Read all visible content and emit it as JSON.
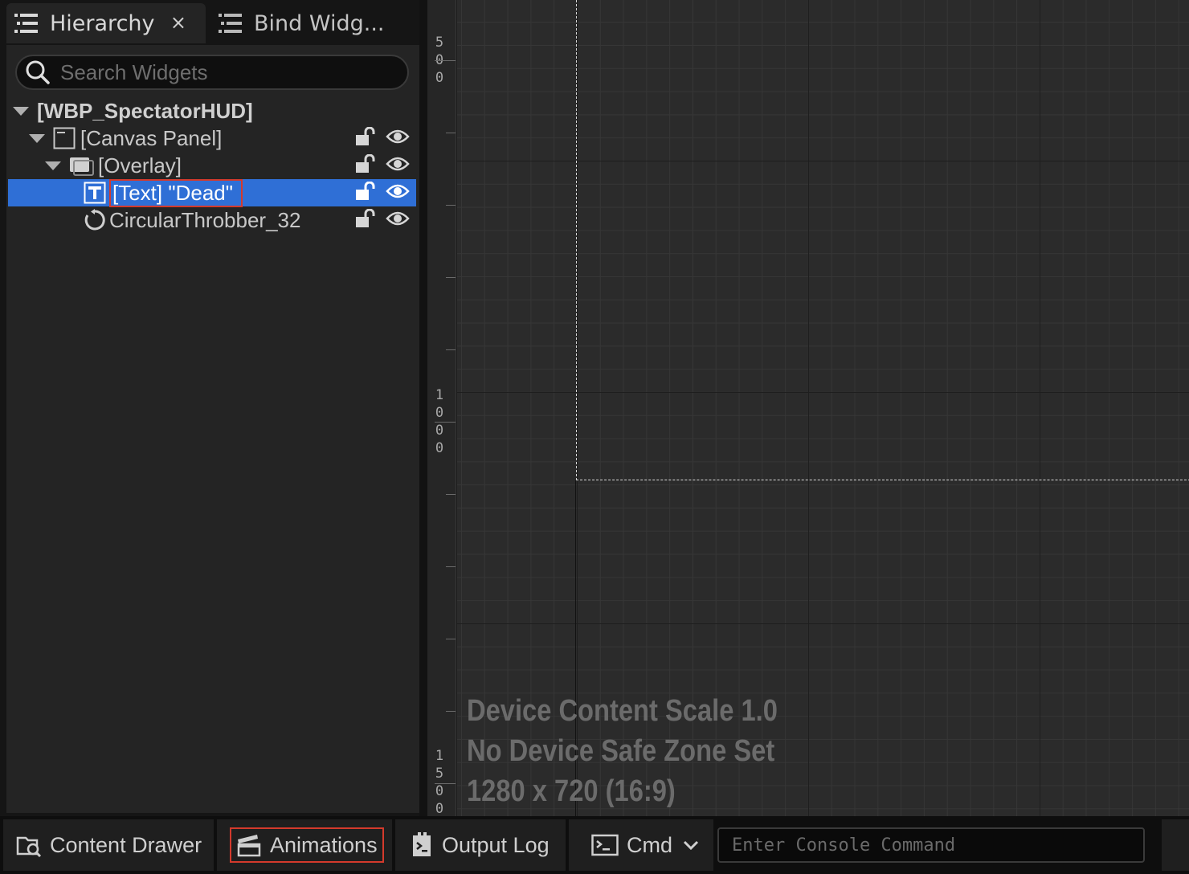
{
  "tabs": [
    {
      "label": "Hierarchy",
      "icon": "hierarchy-list-icon",
      "active": true,
      "close": "×"
    },
    {
      "label": "Bind Widg...",
      "icon": "hierarchy-list-icon",
      "active": false
    }
  ],
  "search": {
    "placeholder": "Search Widgets",
    "value": ""
  },
  "tree": {
    "root": "[WBP_SpectatorHUD]",
    "canvas_panel": "[Canvas Panel]",
    "overlay": "[Overlay]",
    "text_dead": "[Text] \"Dead\"",
    "throbber": "CircularThrobber_32"
  },
  "ruler": {
    "label_500": [
      "5",
      "0",
      "0"
    ],
    "label_1000": [
      "1",
      "0",
      "0",
      "0"
    ],
    "label_1500": [
      "1",
      "5",
      "0",
      "0"
    ]
  },
  "canvas_info": {
    "line1": "Device Content Scale 1.0",
    "line2": "No Device Safe Zone Set",
    "line3": "1280 x 720 (16:9)"
  },
  "bottom_bar": {
    "content_drawer": "Content Drawer",
    "animations": "Animations",
    "output_log": "Output Log",
    "cmd": "Cmd",
    "console_placeholder": "Enter Console Command"
  },
  "colors": {
    "selection": "#2f6fd6",
    "highlight_box": "#d43a2c"
  }
}
